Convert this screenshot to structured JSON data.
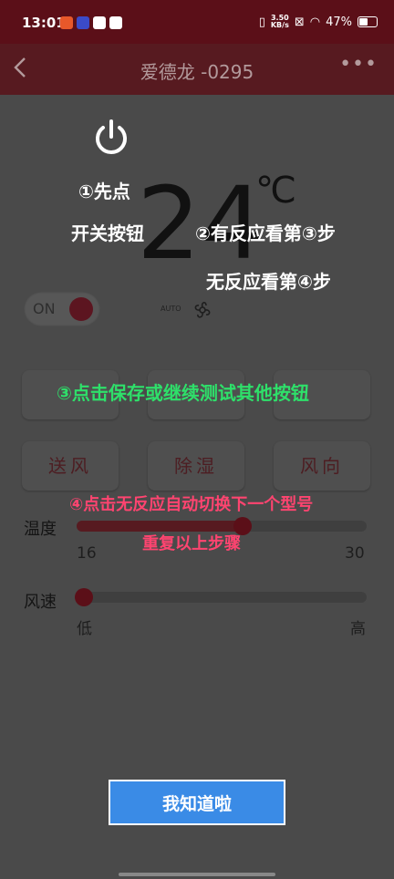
{
  "status_bar": {
    "time": "13:01",
    "speed_top": "3.50",
    "speed_unit": "KB/s",
    "battery": "47%"
  },
  "header": {
    "title": "爱德龙 -0295",
    "back_icon": "chevron-left-icon",
    "more_icon": "more-dots-icon"
  },
  "main": {
    "temperature": "24",
    "unit": "℃",
    "power_toggle": "ON",
    "mode_auto": "AUTO",
    "buttons": [
      "送风",
      "除湿",
      "风向"
    ],
    "temp_slider": {
      "label": "温度",
      "min": "16",
      "max": "30",
      "value": 24
    },
    "speed_slider": {
      "label": "风速",
      "min": "低",
      "max": "高",
      "value": 0
    }
  },
  "guide": {
    "step1_line1": "①先点",
    "step1_line2": "开关按钮",
    "step2": "②有反应看第③步",
    "step2b": "无反应看第④步",
    "step3": "③点击保存或继续测试其他按钮",
    "step4_line1": "④点击无反应自动切换下一个型号",
    "step4_line2": "重复以上步骤",
    "confirm": "我知道啦"
  },
  "colors": {
    "header": "#571a20",
    "accent": "#5b0f18",
    "confirm_button": "#3a8be6",
    "green_text": "#2ee06a",
    "red_text": "#ff4470"
  }
}
